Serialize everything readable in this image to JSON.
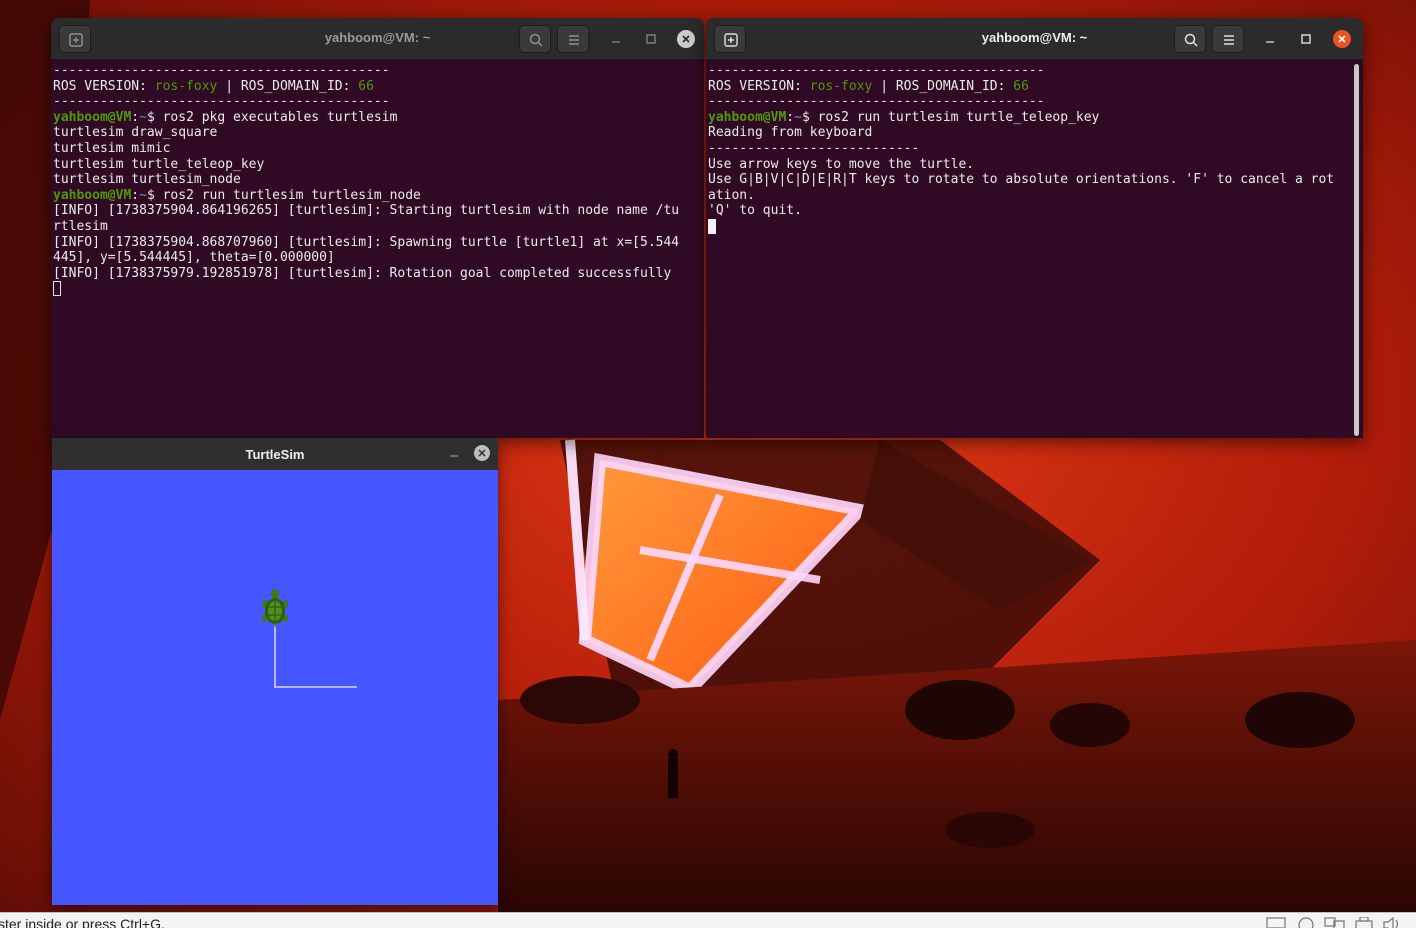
{
  "colors": {
    "terminal_bg": "#300a24",
    "prompt_green": "#4e9a06",
    "path_blue": "#6f8fcf",
    "ubuntu_orange": "#e95420",
    "turtlesim_bg": "#4556ff"
  },
  "terminal_left": {
    "title": "yahboom@VM: ~",
    "new_tab_icon": "new-tab-icon",
    "search_icon": "search-icon",
    "menu_icon": "hamburger-icon",
    "lines": [
      {
        "segs": [
          {
            "t": "-------------------------------------------",
            "c": ""
          }
        ]
      },
      {
        "segs": [
          {
            "t": "ROS VERSION: ",
            "c": ""
          },
          {
            "t": "ros-foxy",
            "c": "olive"
          },
          {
            "t": " | ROS_DOMAIN_ID: ",
            "c": ""
          },
          {
            "t": "66",
            "c": "olive"
          }
        ]
      },
      {
        "segs": [
          {
            "t": "-------------------------------------------",
            "c": ""
          }
        ]
      },
      {
        "segs": [
          {
            "t": "yahboom@VM",
            "c": "green"
          },
          {
            "t": ":",
            "c": ""
          },
          {
            "t": "~",
            "c": "blue"
          },
          {
            "t": "$ ros2 pkg executables turtlesim",
            "c": ""
          }
        ]
      },
      {
        "segs": [
          {
            "t": "turtlesim draw_square",
            "c": ""
          }
        ]
      },
      {
        "segs": [
          {
            "t": "turtlesim mimic",
            "c": ""
          }
        ]
      },
      {
        "segs": [
          {
            "t": "turtlesim turtle_teleop_key",
            "c": ""
          }
        ]
      },
      {
        "segs": [
          {
            "t": "turtlesim turtlesim_node",
            "c": ""
          }
        ]
      },
      {
        "segs": [
          {
            "t": "yahboom@VM",
            "c": "green"
          },
          {
            "t": ":",
            "c": ""
          },
          {
            "t": "~",
            "c": "blue"
          },
          {
            "t": "$ ros2 run turtlesim turtlesim_node",
            "c": ""
          }
        ]
      },
      {
        "segs": [
          {
            "t": "[INFO] [1738375904.864196265] [turtlesim]: Starting turtlesim with node name /tu",
            "c": ""
          }
        ]
      },
      {
        "segs": [
          {
            "t": "rtlesim",
            "c": ""
          }
        ]
      },
      {
        "segs": [
          {
            "t": "[INFO] [1738375904.868707960] [turtlesim]: Spawning turtle [turtle1] at x=[5.544",
            "c": ""
          }
        ]
      },
      {
        "segs": [
          {
            "t": "445], y=[5.544445], theta=[0.000000]",
            "c": ""
          }
        ]
      },
      {
        "segs": [
          {
            "t": "[INFO] [1738375979.192851978] [turtlesim]: Rotation goal completed successfully",
            "c": ""
          }
        ]
      }
    ]
  },
  "terminal_right": {
    "title": "yahboom@VM: ~",
    "lines": [
      {
        "segs": [
          {
            "t": "-------------------------------------------",
            "c": ""
          }
        ]
      },
      {
        "segs": [
          {
            "t": "ROS VERSION: ",
            "c": ""
          },
          {
            "t": "ros-foxy",
            "c": "olive"
          },
          {
            "t": " | ROS_DOMAIN_ID: ",
            "c": ""
          },
          {
            "t": "66",
            "c": "olive"
          }
        ]
      },
      {
        "segs": [
          {
            "t": "-------------------------------------------",
            "c": ""
          }
        ]
      },
      {
        "segs": [
          {
            "t": "yahboom@VM",
            "c": "green"
          },
          {
            "t": ":",
            "c": ""
          },
          {
            "t": "~",
            "c": "blue"
          },
          {
            "t": "$ ros2 run turtlesim turtle_teleop_key",
            "c": ""
          }
        ]
      },
      {
        "segs": [
          {
            "t": "Reading from keyboard",
            "c": ""
          }
        ]
      },
      {
        "segs": [
          {
            "t": "---------------------------",
            "c": ""
          }
        ]
      },
      {
        "segs": [
          {
            "t": "Use arrow keys to move the turtle.",
            "c": ""
          }
        ]
      },
      {
        "segs": [
          {
            "t": "Use G|B|V|C|D|E|R|T keys to rotate to absolute orientations. 'F' to cancel a rot",
            "c": ""
          }
        ]
      },
      {
        "segs": [
          {
            "t": "ation.",
            "c": ""
          }
        ]
      },
      {
        "segs": [
          {
            "t": "'Q' to quit.",
            "c": ""
          }
        ]
      }
    ]
  },
  "turtlesim": {
    "title": "TurtleSim",
    "turtle_icon": "turtle-icon"
  },
  "status_bar": {
    "text": "ster inside or press Ctrl+G."
  }
}
